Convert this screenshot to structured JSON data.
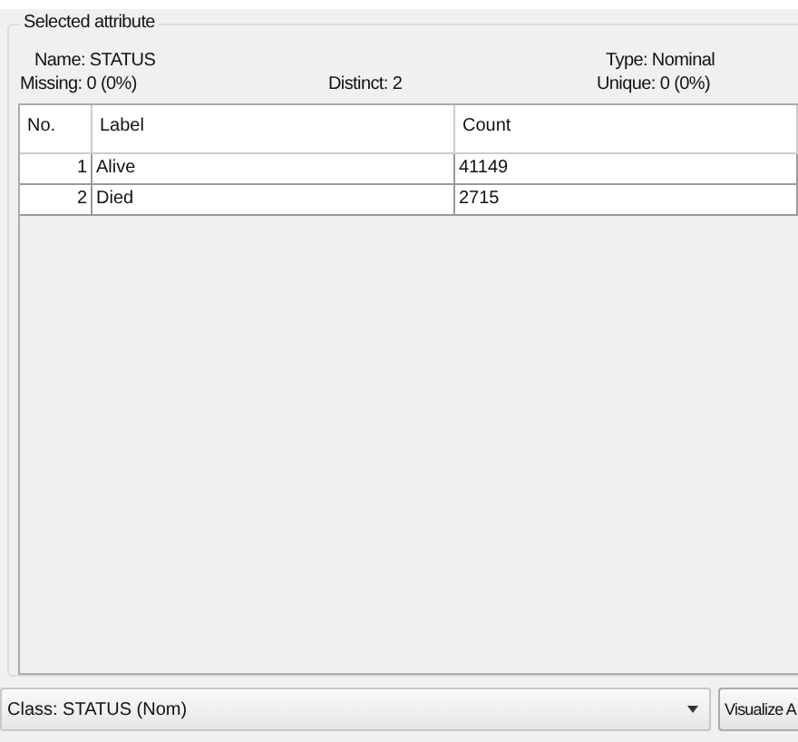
{
  "group_title": "Selected attribute",
  "info": {
    "name": "Name: STATUS",
    "type": "Type: Nominal",
    "missing": "Missing: 0 (0%)",
    "distinct": "Distinct: 2",
    "unique": "Unique: 0 (0%)"
  },
  "table": {
    "columns": [
      "No.",
      "Label",
      "Count"
    ],
    "rows": [
      {
        "no": "1",
        "label": "Alive",
        "count": "41149"
      },
      {
        "no": "2",
        "label": "Died",
        "count": "2715"
      }
    ]
  },
  "class_select": {
    "value": "Class: STATUS (Nom)"
  },
  "visualize_button": "Visualize A"
}
